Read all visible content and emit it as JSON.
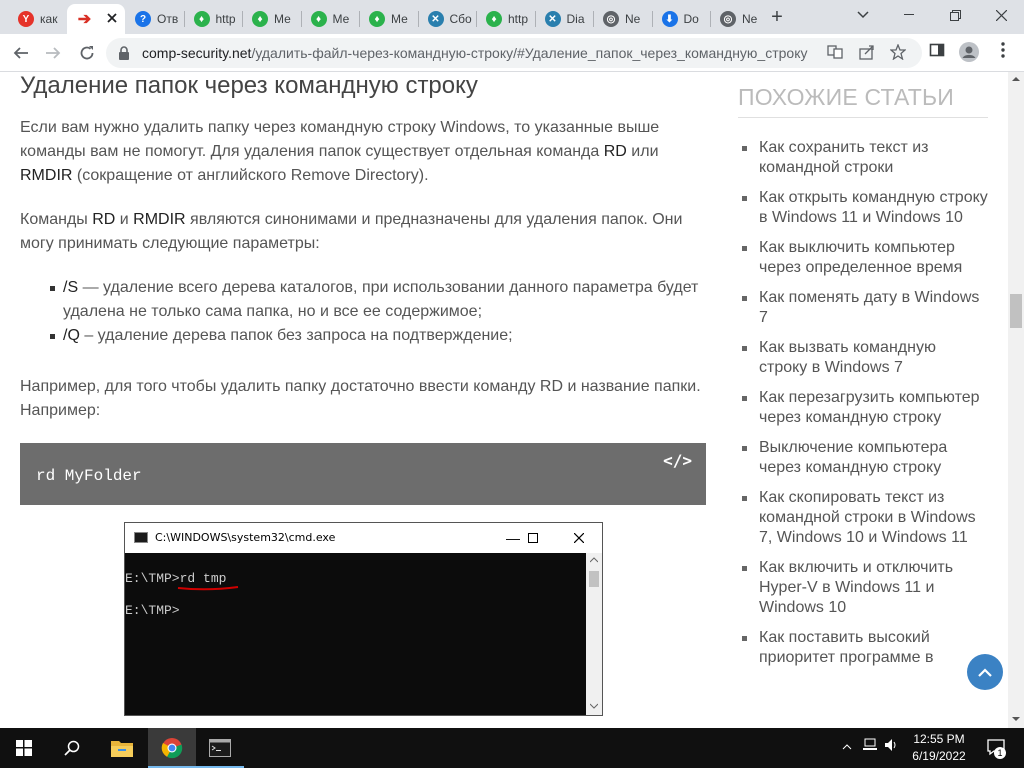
{
  "tabs": [
    {
      "title": "как",
      "fav_color": "#e5332a",
      "fav_char": "Y"
    },
    {
      "title": "",
      "fav_color": "#ffffff",
      "fav_char": "➔",
      "active": true
    },
    {
      "title": "Отв",
      "fav_color": "#1a73e8",
      "fav_char": "?"
    },
    {
      "title": "http",
      "fav_color": "#2bb24c",
      "fav_char": "♦"
    },
    {
      "title": "Ме",
      "fav_color": "#2bb24c",
      "fav_char": "♦"
    },
    {
      "title": "Ме",
      "fav_color": "#2bb24c",
      "fav_char": "♦"
    },
    {
      "title": "Ме",
      "fav_color": "#2bb24c",
      "fav_char": "♦"
    },
    {
      "title": "Сбо",
      "fav_color": "#2a7fae",
      "fav_char": "✕"
    },
    {
      "title": "http",
      "fav_color": "#2bb24c",
      "fav_char": "♦"
    },
    {
      "title": "Dia",
      "fav_color": "#2a7fae",
      "fav_char": "✕"
    },
    {
      "title": "Ne",
      "fav_color": "#5f6368",
      "fav_char": "◎"
    },
    {
      "title": "Do",
      "fav_color": "#1a73e8",
      "fav_char": "⬇"
    },
    {
      "title": "Ne",
      "fav_color": "#5f6368",
      "fav_char": "◎"
    }
  ],
  "browser": {
    "new_tab": "+",
    "url_domain": "comp-security.net",
    "url_path": "/удалить-файл-через-командную-строку/#Удаление_папок_через_командную_строку"
  },
  "article": {
    "heading": "Удаление папок через командную строку",
    "p1_a": "Если вам нужно удалить папку через командную строку Windows, то указанные выше команды вам не помогут. Для удаления папок существует отдельная команда ",
    "p1_rd": "RD",
    "p1_b": " или ",
    "p1_rmdir": "RMDIR",
    "p1_c": " (сокращение от английского Remove Directory).",
    "p2_a": "Команды ",
    "p2_rd": "RD",
    "p2_b": " и ",
    "p2_rmdir": "RMDIR",
    "p2_c": " являются синонимами и предназначены для удаления папок. Они могу принимать следующие параметры:",
    "params": [
      {
        "key": "/S",
        "text": " — удаление всего дерева каталогов, при использовании данного параметра будет удалена не только сама папка, но и все ее содержимое;"
      },
      {
        "key": "/Q",
        "text": " – удаление дерева папок без запроса на подтверждение;"
      }
    ],
    "p3": "Например, для того чтобы удалить папку достаточно ввести команду RD и название папки. Например:",
    "code": "rd MyFolder",
    "code_icon": "</>"
  },
  "cmd": {
    "title": "C:\\WINDOWS\\system32\\cmd.exe",
    "line1_prompt": "E:\\TMP>",
    "line1_cmd": "rd tmp",
    "line2": "E:\\TMP>"
  },
  "sidebar": {
    "heading": "ПОХОЖИЕ СТАТЬИ",
    "items": [
      "Как сохранить текст из командной строки",
      "Как открыть командную строку в Windows 11 и Windows 10",
      "Как выключить компьютер через определенное время",
      "Как поменять дату в Windows 7",
      "Как вызвать командную строку в Windows 7",
      "Как перезагрузить компьютер через командную строку",
      "Выключение компьютера через командную строку",
      "Как скопировать текст из командной строки в Windows 7, Windows 10 и Windows 11",
      "Как включить и отключить Hyper-V в Windows 11 и Windows 10",
      "Как поставить высокий приоритет программе в"
    ]
  },
  "taskbar": {
    "time": "12:55 PM",
    "date": "6/19/2022",
    "notifications": "1"
  },
  "colors": {
    "accent": "#3b82c4",
    "underline": "#d00000"
  }
}
